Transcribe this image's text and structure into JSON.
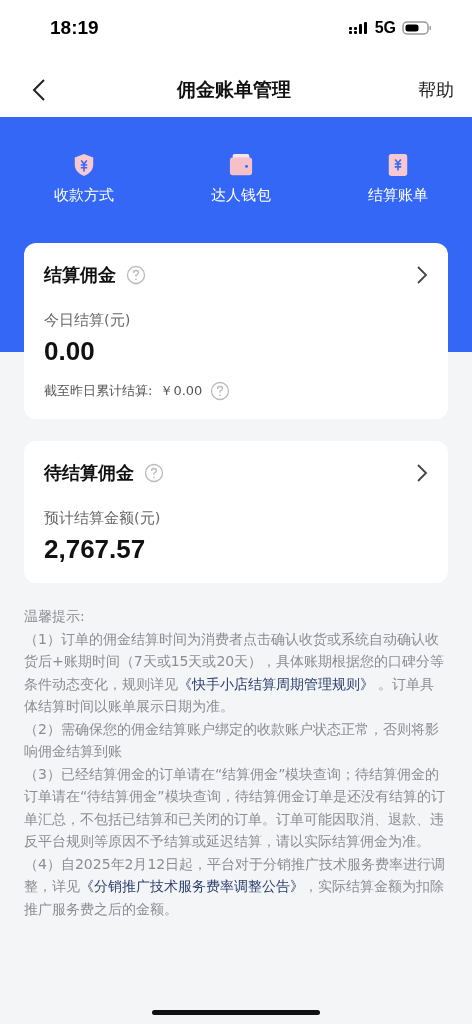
{
  "status_bar": {
    "time": "18:19",
    "network": "5G"
  },
  "nav": {
    "title": "佣金账单管理",
    "action": "帮助"
  },
  "shortcuts": [
    {
      "kind": "shield",
      "label": "收款方式"
    },
    {
      "kind": "wallet",
      "label": "达人钱包"
    },
    {
      "kind": "bill",
      "label": "结算账单"
    }
  ],
  "cards": [
    {
      "title": "结算佣金",
      "amount_label": "今日结算(元)",
      "amount": "0.00",
      "footer": {
        "label": "截至昨日累计结算:",
        "value": "￥0.00"
      }
    },
    {
      "title": "待结算佣金",
      "amount_label": "预计结算金额(元)",
      "amount": "2,767.57"
    }
  ],
  "notes": {
    "title": "温馨提示:",
    "items": [
      {
        "text": "（1）订单的佣金结算时间为消费者点击确认收货或系统自动确认收货后+账期时间（7天或15天或20天），具体账期根据您的口碑分等条件动态变化，规则详见",
        "link": "《快手小店结算周期管理规则》",
        "after": " 。订单具体结算时间以账单展示日期为准。"
      },
      {
        "text": "（2）需确保您的佣金结算账户绑定的收款账户状态正常，否则将影响佣金结算到账"
      },
      {
        "text": "（3）已经结算佣金的订单请在“结算佣金”模块查询；待结算佣金的订单请在“待结算佣金”模块查询，待结算佣金订单是还没有结算的订单汇总，不包括已结算和已关闭的订单。订单可能因取消、退款、违反平台规则等原因不予结算或延迟结算，请以实际结算佣金为准。"
      },
      {
        "text": "（4）自2025年2月12日起，平台对于分销推广技术服务费率进行调整，详见",
        "link": "《分销推广技术服务费率调整公告》",
        "after": "，实际结算金额为扣除推广服务费之后的金额。"
      }
    ]
  }
}
